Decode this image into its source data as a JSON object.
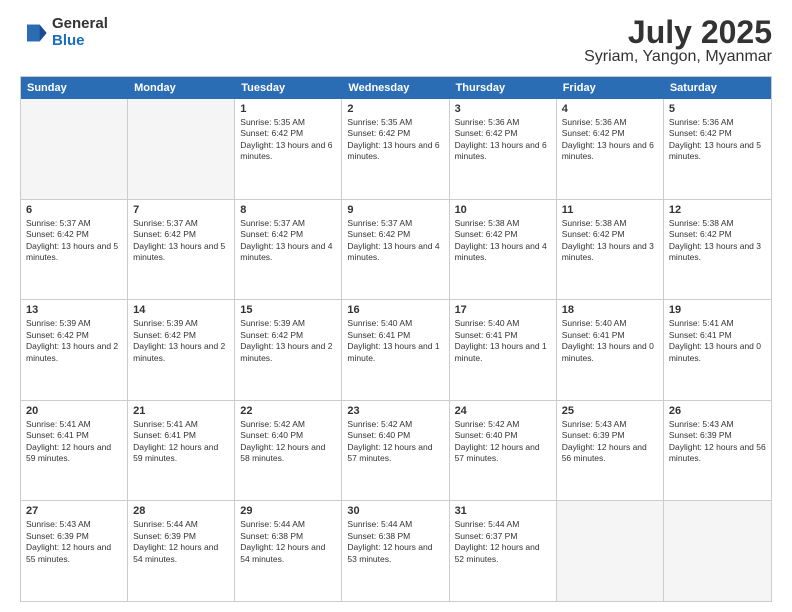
{
  "header": {
    "logo": {
      "line1": "General",
      "line2": "Blue"
    },
    "title": "July 2025",
    "subtitle": "Syriam, Yangon, Myanmar"
  },
  "calendar": {
    "days_of_week": [
      "Sunday",
      "Monday",
      "Tuesday",
      "Wednesday",
      "Thursday",
      "Friday",
      "Saturday"
    ],
    "rows": [
      [
        {
          "day": "",
          "empty": true
        },
        {
          "day": "",
          "empty": true
        },
        {
          "day": "1",
          "sunrise": "5:35 AM",
          "sunset": "6:42 PM",
          "daylight": "13 hours and 6 minutes."
        },
        {
          "day": "2",
          "sunrise": "5:35 AM",
          "sunset": "6:42 PM",
          "daylight": "13 hours and 6 minutes."
        },
        {
          "day": "3",
          "sunrise": "5:36 AM",
          "sunset": "6:42 PM",
          "daylight": "13 hours and 6 minutes."
        },
        {
          "day": "4",
          "sunrise": "5:36 AM",
          "sunset": "6:42 PM",
          "daylight": "13 hours and 6 minutes."
        },
        {
          "day": "5",
          "sunrise": "5:36 AM",
          "sunset": "6:42 PM",
          "daylight": "13 hours and 5 minutes."
        }
      ],
      [
        {
          "day": "6",
          "sunrise": "5:37 AM",
          "sunset": "6:42 PM",
          "daylight": "13 hours and 5 minutes."
        },
        {
          "day": "7",
          "sunrise": "5:37 AM",
          "sunset": "6:42 PM",
          "daylight": "13 hours and 5 minutes."
        },
        {
          "day": "8",
          "sunrise": "5:37 AM",
          "sunset": "6:42 PM",
          "daylight": "13 hours and 4 minutes."
        },
        {
          "day": "9",
          "sunrise": "5:37 AM",
          "sunset": "6:42 PM",
          "daylight": "13 hours and 4 minutes."
        },
        {
          "day": "10",
          "sunrise": "5:38 AM",
          "sunset": "6:42 PM",
          "daylight": "13 hours and 4 minutes."
        },
        {
          "day": "11",
          "sunrise": "5:38 AM",
          "sunset": "6:42 PM",
          "daylight": "13 hours and 3 minutes."
        },
        {
          "day": "12",
          "sunrise": "5:38 AM",
          "sunset": "6:42 PM",
          "daylight": "13 hours and 3 minutes."
        }
      ],
      [
        {
          "day": "13",
          "sunrise": "5:39 AM",
          "sunset": "6:42 PM",
          "daylight": "13 hours and 2 minutes."
        },
        {
          "day": "14",
          "sunrise": "5:39 AM",
          "sunset": "6:42 PM",
          "daylight": "13 hours and 2 minutes."
        },
        {
          "day": "15",
          "sunrise": "5:39 AM",
          "sunset": "6:42 PM",
          "daylight": "13 hours and 2 minutes."
        },
        {
          "day": "16",
          "sunrise": "5:40 AM",
          "sunset": "6:41 PM",
          "daylight": "13 hours and 1 minute."
        },
        {
          "day": "17",
          "sunrise": "5:40 AM",
          "sunset": "6:41 PM",
          "daylight": "13 hours and 1 minute."
        },
        {
          "day": "18",
          "sunrise": "5:40 AM",
          "sunset": "6:41 PM",
          "daylight": "13 hours and 0 minutes."
        },
        {
          "day": "19",
          "sunrise": "5:41 AM",
          "sunset": "6:41 PM",
          "daylight": "13 hours and 0 minutes."
        }
      ],
      [
        {
          "day": "20",
          "sunrise": "5:41 AM",
          "sunset": "6:41 PM",
          "daylight": "12 hours and 59 minutes."
        },
        {
          "day": "21",
          "sunrise": "5:41 AM",
          "sunset": "6:41 PM",
          "daylight": "12 hours and 59 minutes."
        },
        {
          "day": "22",
          "sunrise": "5:42 AM",
          "sunset": "6:40 PM",
          "daylight": "12 hours and 58 minutes."
        },
        {
          "day": "23",
          "sunrise": "5:42 AM",
          "sunset": "6:40 PM",
          "daylight": "12 hours and 57 minutes."
        },
        {
          "day": "24",
          "sunrise": "5:42 AM",
          "sunset": "6:40 PM",
          "daylight": "12 hours and 57 minutes."
        },
        {
          "day": "25",
          "sunrise": "5:43 AM",
          "sunset": "6:39 PM",
          "daylight": "12 hours and 56 minutes."
        },
        {
          "day": "26",
          "sunrise": "5:43 AM",
          "sunset": "6:39 PM",
          "daylight": "12 hours and 56 minutes."
        }
      ],
      [
        {
          "day": "27",
          "sunrise": "5:43 AM",
          "sunset": "6:39 PM",
          "daylight": "12 hours and 55 minutes."
        },
        {
          "day": "28",
          "sunrise": "5:44 AM",
          "sunset": "6:39 PM",
          "daylight": "12 hours and 54 minutes."
        },
        {
          "day": "29",
          "sunrise": "5:44 AM",
          "sunset": "6:38 PM",
          "daylight": "12 hours and 54 minutes."
        },
        {
          "day": "30",
          "sunrise": "5:44 AM",
          "sunset": "6:38 PM",
          "daylight": "12 hours and 53 minutes."
        },
        {
          "day": "31",
          "sunrise": "5:44 AM",
          "sunset": "6:37 PM",
          "daylight": "12 hours and 52 minutes."
        },
        {
          "day": "",
          "empty": true
        },
        {
          "day": "",
          "empty": true
        }
      ]
    ]
  }
}
